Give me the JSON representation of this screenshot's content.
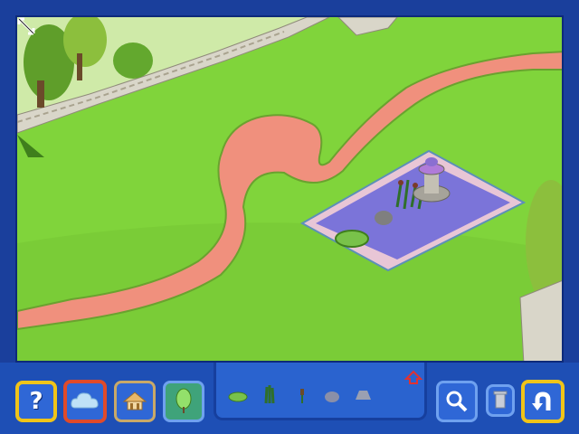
{
  "toolbar": {
    "help_label": "?",
    "buttons": [
      {
        "name": "help-button",
        "icon": "question-mark-icon",
        "style": "yellow"
      },
      {
        "name": "water-features-button",
        "icon": "cloud-pond-icon",
        "style": "red",
        "selected": true
      },
      {
        "name": "buildings-button",
        "icon": "house-icon",
        "style": "tan"
      },
      {
        "name": "plants-button",
        "icon": "tree-icon",
        "style": "teal"
      },
      {
        "name": "zoom-button",
        "icon": "magnifier-icon",
        "style": "blue"
      },
      {
        "name": "trash-button",
        "icon": "trash-can-icon",
        "style": "blue"
      },
      {
        "name": "undo-button",
        "icon": "undo-arrow-icon",
        "style": "yellow"
      }
    ]
  },
  "tray": {
    "items": [
      {
        "name": "tray-item-lily-pad",
        "icon": "lily-pad-icon"
      },
      {
        "name": "tray-item-reeds",
        "icon": "reeds-icon"
      },
      {
        "name": "tray-item-cattail",
        "icon": "cattail-icon"
      },
      {
        "name": "tray-item-rock",
        "icon": "rock-icon"
      },
      {
        "name": "tray-item-stone",
        "icon": "stone-icon"
      }
    ],
    "scroll_up_icon": "up-arrow-icon"
  },
  "scene": {
    "objects": [
      "path",
      "stone-wall",
      "pond",
      "fountain",
      "trees"
    ]
  },
  "colors": {
    "grass": "#7fd23a",
    "path": "#f0907d",
    "frame": "#1a3f9c",
    "toolbar": "#1e4fb5",
    "accent_yellow": "#f0c419",
    "accent_red": "#e04a2a"
  }
}
